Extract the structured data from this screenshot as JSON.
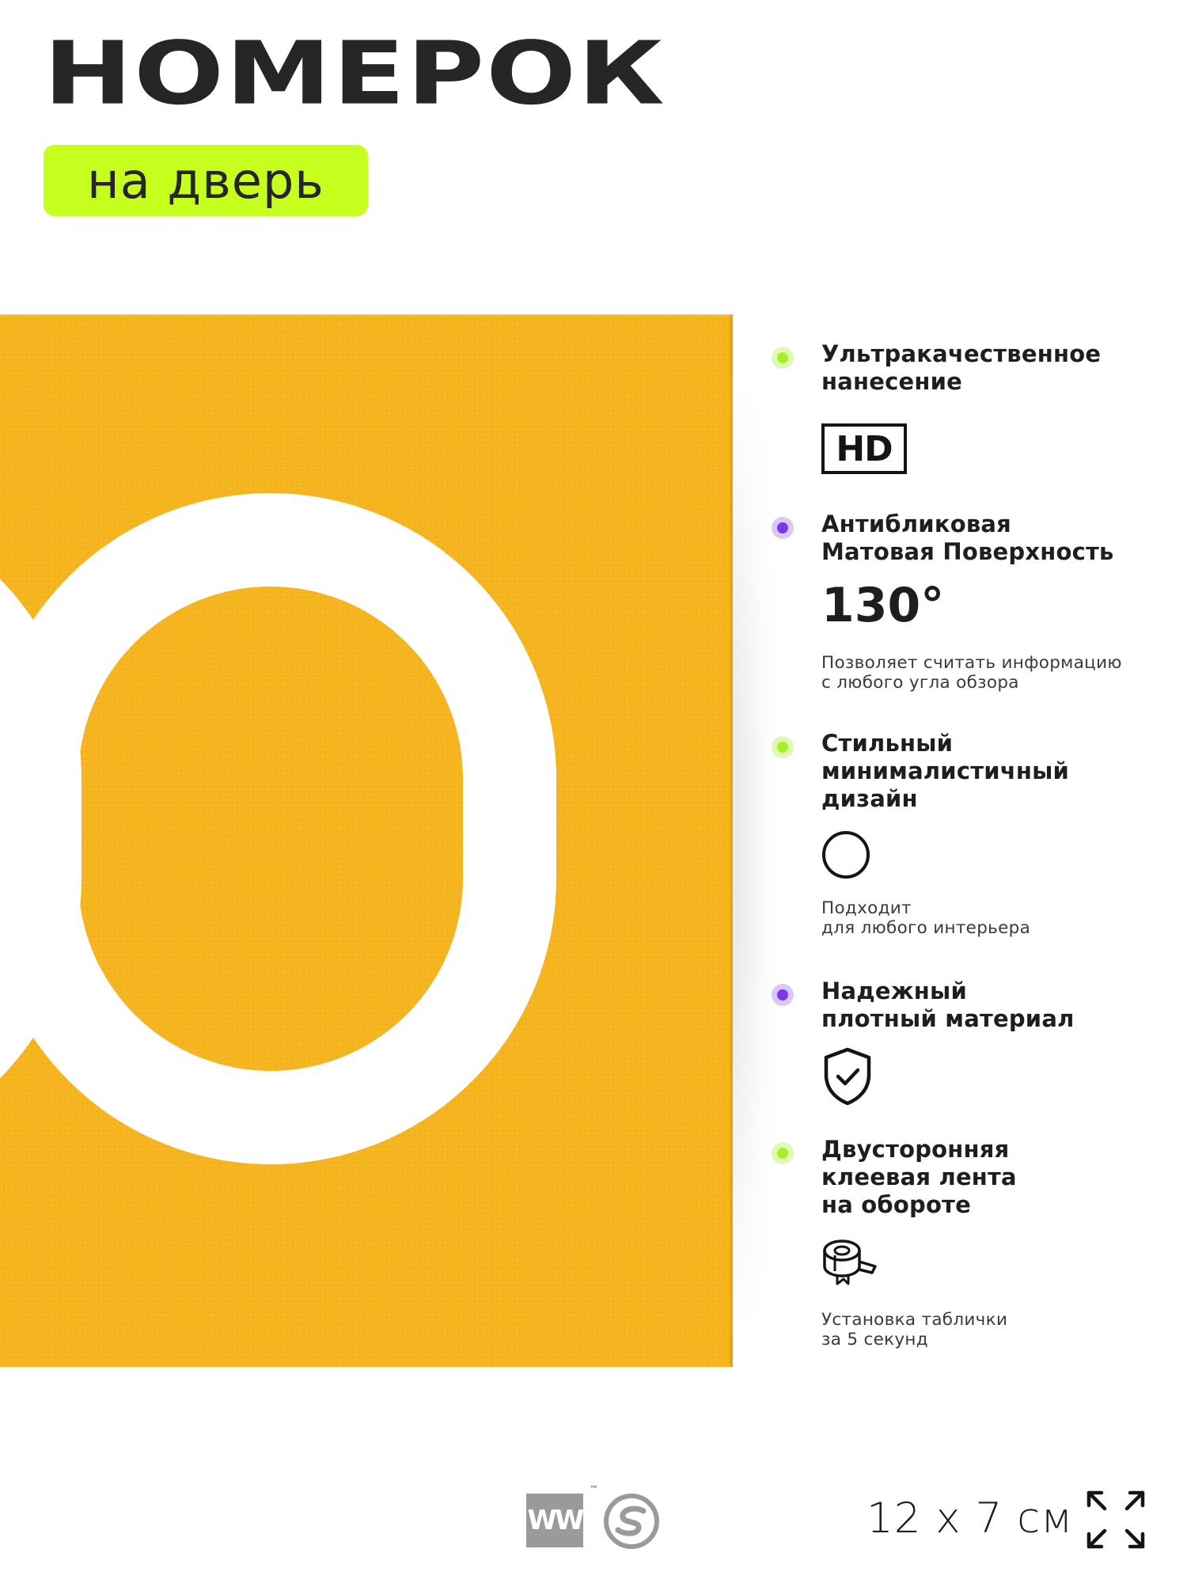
{
  "header": {
    "title": "НОМЕРОК",
    "subtitle": "на дверь",
    "accent_color": "#c6ff1e"
  },
  "product": {
    "sign_color": "#f6b41d",
    "digits_color": "#ffffff",
    "visible_digits": "0"
  },
  "features": [
    {
      "icon": "green-bullet-icon",
      "title": "Ультракачественное\nнанесение",
      "badge": "HD",
      "note": ""
    },
    {
      "icon": "purple-bullet-icon",
      "title": "Антибликовая\nМатовая Поверхность",
      "value": "130°",
      "note": "Позволяет считать информацию\nс любого угла обзора"
    },
    {
      "icon": "green-bullet-icon",
      "title": "Стильный\nминималистичный\nдизайн",
      "symbol": "circle-icon",
      "note": "Подходит\nдля любого интерьера"
    },
    {
      "icon": "purple-bullet-icon",
      "title": "Надежный\nплотный материал",
      "symbol": "shield-check-icon",
      "note": ""
    },
    {
      "icon": "green-bullet-icon",
      "title": "Двусторонняя\nклеевая лента\nна обороте",
      "symbol": "tape-icon",
      "note": "Установка таблички\nза 5 секунд"
    }
  ],
  "footer": {
    "brand_letters": "W",
    "trademark": "™",
    "size": "12 x 7 см",
    "size_icon": "expand-arrows-icon"
  },
  "colors": {
    "green_bullet": "#a6ef2a",
    "purple_bullet": "#7b38e6"
  }
}
